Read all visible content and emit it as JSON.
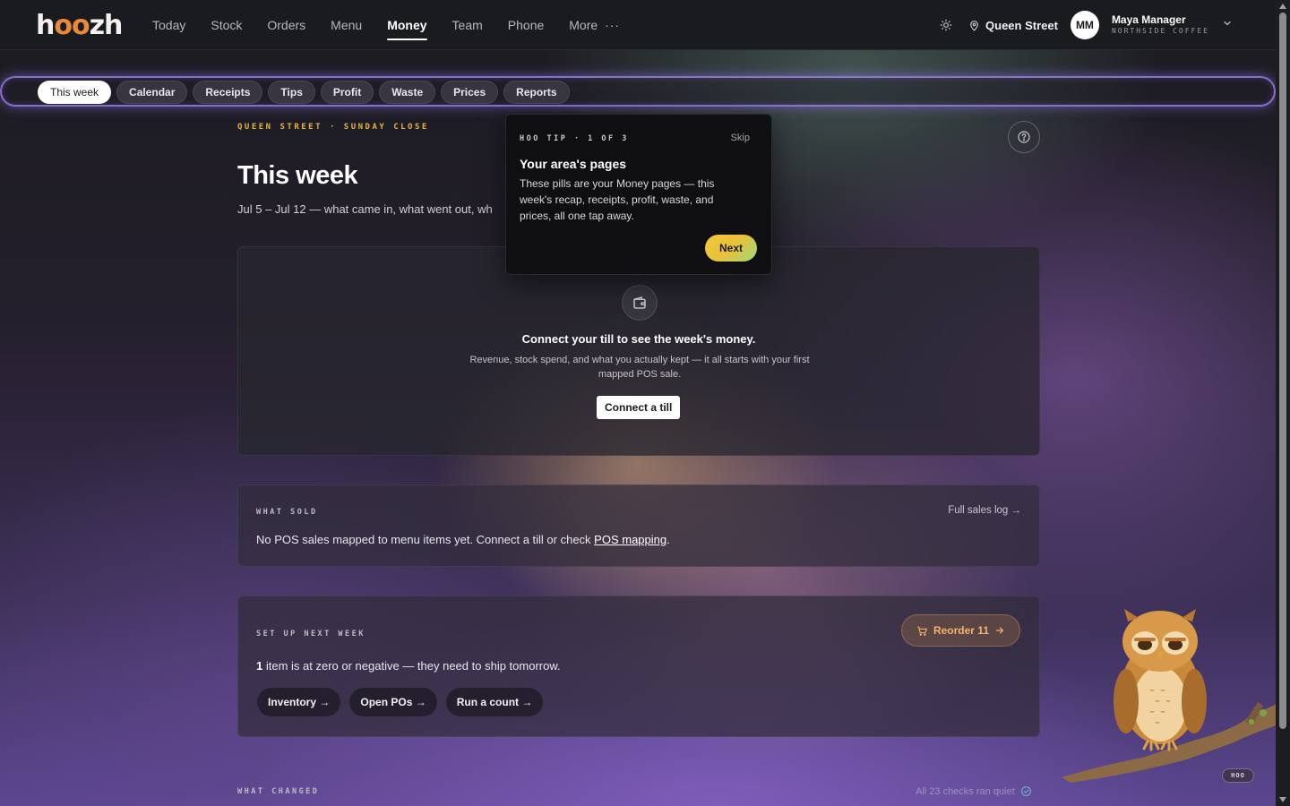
{
  "brand": {
    "logo_pre": "h",
    "logo_oo": "oo",
    "logo_post": "zh"
  },
  "nav": {
    "items": [
      {
        "label": "Today"
      },
      {
        "label": "Stock"
      },
      {
        "label": "Orders"
      },
      {
        "label": "Menu"
      },
      {
        "label": "Money",
        "active": true
      },
      {
        "label": "Team"
      },
      {
        "label": "Phone"
      },
      {
        "label": "More"
      }
    ],
    "more_dots": "···",
    "location": "Queen Street",
    "user_initials": "MM",
    "user_name": "Maya Manager",
    "user_org": "NORTHSIDE COFFEE"
  },
  "pills": [
    {
      "label": "This week",
      "active": true
    },
    {
      "label": "Calendar"
    },
    {
      "label": "Receipts"
    },
    {
      "label": "Tips"
    },
    {
      "label": "Profit"
    },
    {
      "label": "Waste"
    },
    {
      "label": "Prices"
    },
    {
      "label": "Reports"
    }
  ],
  "header": {
    "eyebrow": "QUEEN STREET · SUNDAY CLOSE",
    "title": "This week",
    "subtitle": "Jul 5 – Jul 12 — what came in, what went out, wh"
  },
  "connect": {
    "title": "Connect your till to see the week's money.",
    "body": "Revenue, stock spend, and what you actually kept — it all starts with your first mapped POS sale.",
    "button": "Connect a till"
  },
  "what_sold": {
    "label": "WHAT SOLD",
    "link": "Full sales log →",
    "text_pre": "No POS sales mapped to menu items yet. Connect a till or check ",
    "text_link": "POS mapping",
    "text_post": "."
  },
  "setup": {
    "label": "SET UP NEXT WEEK",
    "reorder": "Reorder 11",
    "count": "1",
    "text": " item is at zero or negative — they need to ship tomorrow.",
    "actions": [
      "Inventory →",
      "Open POs →",
      "Run a count →"
    ]
  },
  "what_changed": {
    "label": "WHAT CHANGED",
    "status": "All 23 checks ran quiet"
  },
  "tip": {
    "eyebrow": "HOO TIP · 1 OF 3",
    "skip": "Skip",
    "title": "Your area's pages",
    "body": "These pills are your Money pages — this week's recap, receipts, profit, waste, and prices, all one tap away.",
    "next": "Next"
  },
  "mascot": {
    "badge": "HOO"
  },
  "colors": {
    "accent_gold": "#e7b23d",
    "logo_orange": "#e98a3a",
    "reorder_orange": "#f3b46c",
    "pillbar_glow": "#aa8cff"
  },
  "icons": {
    "theme": "sun-icon",
    "location": "map-pin-icon",
    "user_menu": "chevron-down-icon",
    "help": "question-circle-icon",
    "connect": "wallet-icon",
    "reorder": "cart-icon",
    "status": "check-circle-icon"
  }
}
